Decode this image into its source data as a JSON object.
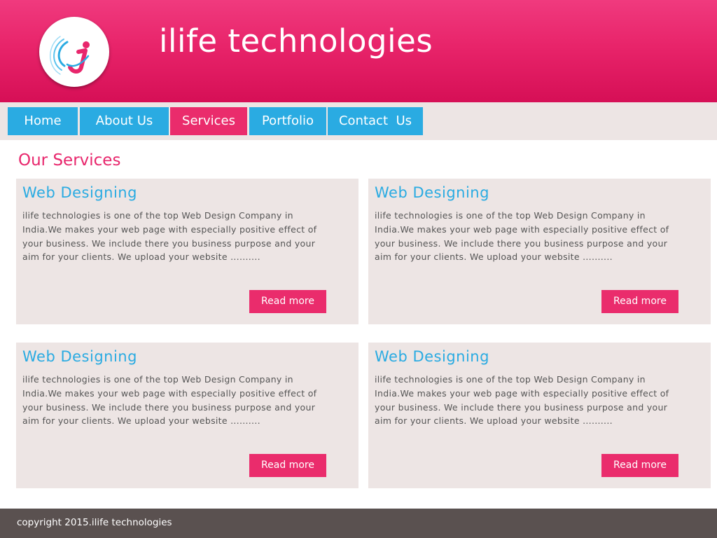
{
  "header": {
    "logo_icon": "ilife-logo-icon",
    "title": "ilife technologies"
  },
  "nav": {
    "items": [
      {
        "label": "Home",
        "active": false
      },
      {
        "label": "About Us",
        "active": false
      },
      {
        "label": "Services",
        "active": true
      },
      {
        "label": "Portfolio",
        "active": false
      },
      {
        "label": "Contact  Us",
        "active": false
      }
    ]
  },
  "main": {
    "section_title": "Our Services",
    "cards": [
      {
        "title": "Web Designing",
        "text": "ilife technologies is one of the top Web Design Company in India.We makes your web page with especially positive effect of your business. We include there you business purpose and your aim for your clients. We upload your website ..........",
        "button_label": "Read more"
      },
      {
        "title": "Web Designing",
        "text": "ilife technologies is one of the top Web Design Company in India.We makes your web page with especially positive effect of your business. We include there you business purpose and your aim for your clients. We upload your website ..........",
        "button_label": "Read more"
      },
      {
        "title": "Web Designing",
        "text": "ilife technologies is one of the top Web Design Company in India.We makes your web page with especially positive effect of your business. We include there you business purpose and your aim for your clients. We upload your website ..........",
        "button_label": "Read more"
      },
      {
        "title": "Web Designing",
        "text": "ilife technologies is one of the top Web Design Company in India.We makes your web page with especially positive effect of your business. We include there you business purpose and your aim for your clients. We upload your website ..........",
        "button_label": "Read more"
      }
    ]
  },
  "footer": {
    "copyright": "copyright 2015.ilife technologies"
  },
  "colors": {
    "brand_pink": "#ea2c6c",
    "nav_blue": "#2aabe2",
    "card_bg": "#ede5e4",
    "footer_bg": "#5a5150"
  }
}
